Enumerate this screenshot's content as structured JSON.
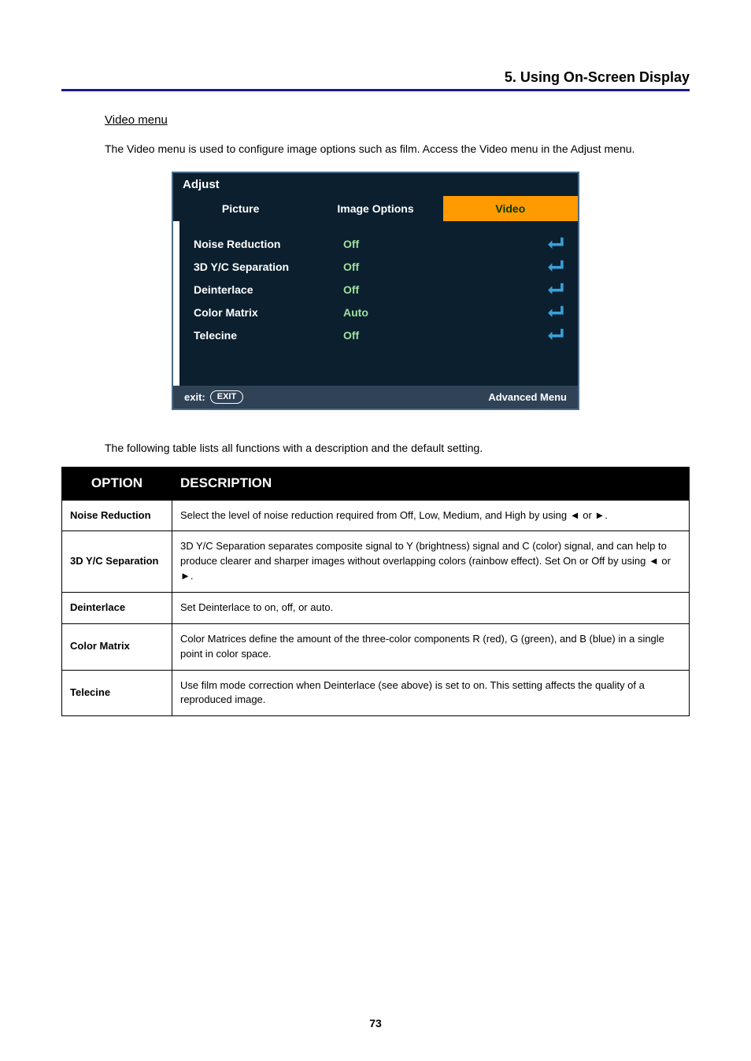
{
  "header": {
    "section_title": "5. Using On-Screen Display"
  },
  "video_menu": {
    "label": "Video menu",
    "desc": "The Video menu is used to configure image options such as film. Access the Video menu in the Adjust menu."
  },
  "osd": {
    "title": "Adjust",
    "tabs": {
      "picture": "Picture",
      "image_options": "Image Options",
      "video": "Video"
    },
    "rows": [
      {
        "label": "Noise Reduction",
        "value": "Off"
      },
      {
        "label": "3D Y/C Separation",
        "value": "Off"
      },
      {
        "label": "Deinterlace",
        "value": "Off"
      },
      {
        "label": "Color Matrix",
        "value": "Auto"
      },
      {
        "label": "Telecine",
        "value": "Off"
      }
    ],
    "footer": {
      "exit_label": "exit:",
      "exit_btn": "EXIT",
      "menu_mode": "Advanced Menu"
    }
  },
  "table_intro": "The following table lists all functions with a description and the default setting.",
  "opt_table": {
    "head": {
      "option": "OPTION",
      "desc": "DESCRIPTION"
    },
    "rows": [
      {
        "option": "Noise Reduction",
        "desc": "Select the level of noise reduction required from Off, Low, Medium, and High by using ◄ or ►."
      },
      {
        "option": "3D Y/C Separation",
        "desc": "3D Y/C Separation separates composite signal to Y (brightness) signal and C (color) signal, and can help to produce clearer and sharper images without overlapping colors (rainbow effect). Set On or Off by using ◄ or ►."
      },
      {
        "option": "Deinterlace",
        "desc": "Set Deinterlace to on, off, or auto."
      },
      {
        "option": "Color Matrix",
        "desc": "Color Matrices define the amount of the three-color components R (red), G (green), and B (blue) in a single point in color space."
      },
      {
        "option": "Telecine",
        "desc": "Use film mode correction when Deinterlace (see above) is set to on. This setting affects the quality of a reproduced image."
      }
    ]
  },
  "page_number": "73"
}
